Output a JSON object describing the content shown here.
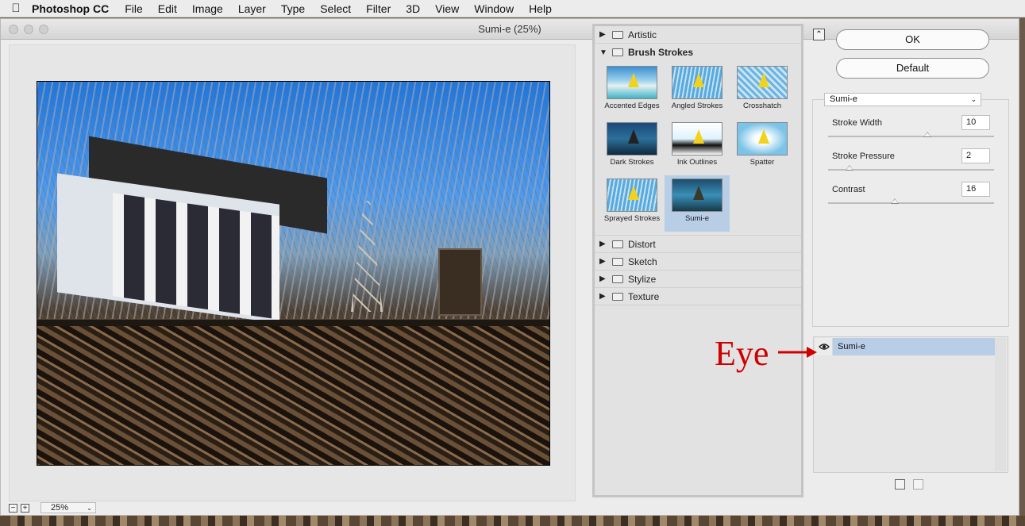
{
  "menubar": {
    "apple_icon": "apple-icon",
    "app_name": "Photoshop CC",
    "items": [
      "File",
      "Edit",
      "Image",
      "Layer",
      "Type",
      "Select",
      "Filter",
      "3D",
      "View",
      "Window",
      "Help"
    ]
  },
  "window": {
    "title": "Sumi-e (25%)"
  },
  "preview": {
    "zoom": "25%",
    "minus": "−",
    "plus": "+"
  },
  "gallery": {
    "categories_top": [
      {
        "label": "Artistic",
        "expanded": false
      }
    ],
    "open_category": {
      "label": "Brush Strokes",
      "expanded": true
    },
    "thumbnails": [
      {
        "label": "Accented Edges",
        "selected": false
      },
      {
        "label": "Angled Strokes",
        "selected": false
      },
      {
        "label": "Crosshatch",
        "selected": false
      },
      {
        "label": "Dark Strokes",
        "selected": false
      },
      {
        "label": "Ink Outlines",
        "selected": false
      },
      {
        "label": "Spatter",
        "selected": false
      },
      {
        "label": "Sprayed Strokes",
        "selected": false
      },
      {
        "label": "Sumi-e",
        "selected": true
      }
    ],
    "categories_bottom": [
      {
        "label": "Distort"
      },
      {
        "label": "Sketch"
      },
      {
        "label": "Stylize"
      },
      {
        "label": "Texture"
      }
    ]
  },
  "buttons": {
    "ok": "OK",
    "default": "Default"
  },
  "filter_select": {
    "value": "Sumi-e"
  },
  "params": [
    {
      "label": "Stroke Width",
      "value": "10",
      "fraction": 0.6
    },
    {
      "label": "Stroke Pressure",
      "value": "2",
      "fraction": 0.13
    },
    {
      "label": "Contrast",
      "value": "16",
      "fraction": 0.4
    }
  ],
  "layers": [
    {
      "name": "Sumi-e",
      "visible": true
    }
  ],
  "annotation": {
    "text": "Eye",
    "color": "#d10000"
  },
  "colors": {
    "selection": "#b8cde6",
    "annotation": "#d10000"
  }
}
